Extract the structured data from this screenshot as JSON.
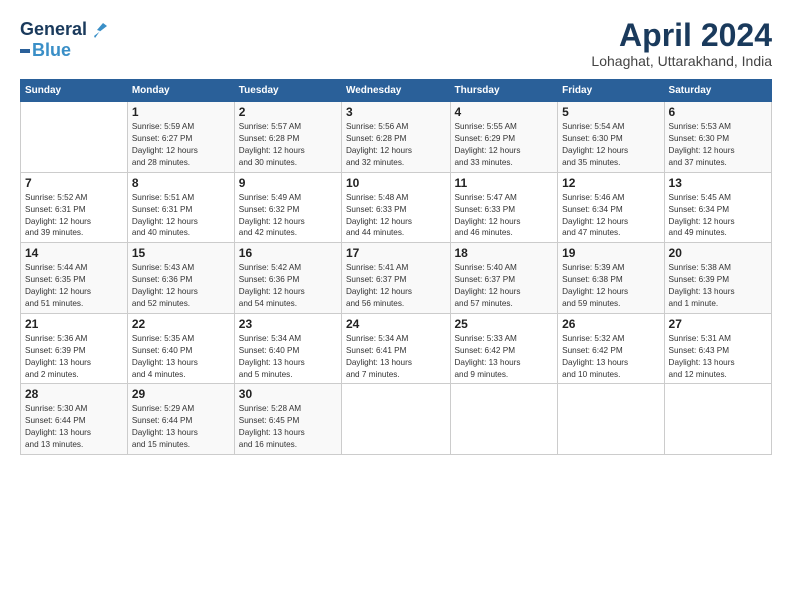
{
  "logo": {
    "line1": "General",
    "line2": "Blue"
  },
  "title": "April 2024",
  "location": "Lohaghat, Uttarakhand, India",
  "days_of_week": [
    "Sunday",
    "Monday",
    "Tuesday",
    "Wednesday",
    "Thursday",
    "Friday",
    "Saturday"
  ],
  "weeks": [
    [
      {
        "day": "",
        "data": ""
      },
      {
        "day": "1",
        "data": "Sunrise: 5:59 AM\nSunset: 6:27 PM\nDaylight: 12 hours\nand 28 minutes."
      },
      {
        "day": "2",
        "data": "Sunrise: 5:57 AM\nSunset: 6:28 PM\nDaylight: 12 hours\nand 30 minutes."
      },
      {
        "day": "3",
        "data": "Sunrise: 5:56 AM\nSunset: 6:28 PM\nDaylight: 12 hours\nand 32 minutes."
      },
      {
        "day": "4",
        "data": "Sunrise: 5:55 AM\nSunset: 6:29 PM\nDaylight: 12 hours\nand 33 minutes."
      },
      {
        "day": "5",
        "data": "Sunrise: 5:54 AM\nSunset: 6:30 PM\nDaylight: 12 hours\nand 35 minutes."
      },
      {
        "day": "6",
        "data": "Sunrise: 5:53 AM\nSunset: 6:30 PM\nDaylight: 12 hours\nand 37 minutes."
      }
    ],
    [
      {
        "day": "7",
        "data": "Sunrise: 5:52 AM\nSunset: 6:31 PM\nDaylight: 12 hours\nand 39 minutes."
      },
      {
        "day": "8",
        "data": "Sunrise: 5:51 AM\nSunset: 6:31 PM\nDaylight: 12 hours\nand 40 minutes."
      },
      {
        "day": "9",
        "data": "Sunrise: 5:49 AM\nSunset: 6:32 PM\nDaylight: 12 hours\nand 42 minutes."
      },
      {
        "day": "10",
        "data": "Sunrise: 5:48 AM\nSunset: 6:33 PM\nDaylight: 12 hours\nand 44 minutes."
      },
      {
        "day": "11",
        "data": "Sunrise: 5:47 AM\nSunset: 6:33 PM\nDaylight: 12 hours\nand 46 minutes."
      },
      {
        "day": "12",
        "data": "Sunrise: 5:46 AM\nSunset: 6:34 PM\nDaylight: 12 hours\nand 47 minutes."
      },
      {
        "day": "13",
        "data": "Sunrise: 5:45 AM\nSunset: 6:34 PM\nDaylight: 12 hours\nand 49 minutes."
      }
    ],
    [
      {
        "day": "14",
        "data": "Sunrise: 5:44 AM\nSunset: 6:35 PM\nDaylight: 12 hours\nand 51 minutes."
      },
      {
        "day": "15",
        "data": "Sunrise: 5:43 AM\nSunset: 6:36 PM\nDaylight: 12 hours\nand 52 minutes."
      },
      {
        "day": "16",
        "data": "Sunrise: 5:42 AM\nSunset: 6:36 PM\nDaylight: 12 hours\nand 54 minutes."
      },
      {
        "day": "17",
        "data": "Sunrise: 5:41 AM\nSunset: 6:37 PM\nDaylight: 12 hours\nand 56 minutes."
      },
      {
        "day": "18",
        "data": "Sunrise: 5:40 AM\nSunset: 6:37 PM\nDaylight: 12 hours\nand 57 minutes."
      },
      {
        "day": "19",
        "data": "Sunrise: 5:39 AM\nSunset: 6:38 PM\nDaylight: 12 hours\nand 59 minutes."
      },
      {
        "day": "20",
        "data": "Sunrise: 5:38 AM\nSunset: 6:39 PM\nDaylight: 13 hours\nand 1 minute."
      }
    ],
    [
      {
        "day": "21",
        "data": "Sunrise: 5:36 AM\nSunset: 6:39 PM\nDaylight: 13 hours\nand 2 minutes."
      },
      {
        "day": "22",
        "data": "Sunrise: 5:35 AM\nSunset: 6:40 PM\nDaylight: 13 hours\nand 4 minutes."
      },
      {
        "day": "23",
        "data": "Sunrise: 5:34 AM\nSunset: 6:40 PM\nDaylight: 13 hours\nand 5 minutes."
      },
      {
        "day": "24",
        "data": "Sunrise: 5:34 AM\nSunset: 6:41 PM\nDaylight: 13 hours\nand 7 minutes."
      },
      {
        "day": "25",
        "data": "Sunrise: 5:33 AM\nSunset: 6:42 PM\nDaylight: 13 hours\nand 9 minutes."
      },
      {
        "day": "26",
        "data": "Sunrise: 5:32 AM\nSunset: 6:42 PM\nDaylight: 13 hours\nand 10 minutes."
      },
      {
        "day": "27",
        "data": "Sunrise: 5:31 AM\nSunset: 6:43 PM\nDaylight: 13 hours\nand 12 minutes."
      }
    ],
    [
      {
        "day": "28",
        "data": "Sunrise: 5:30 AM\nSunset: 6:44 PM\nDaylight: 13 hours\nand 13 minutes."
      },
      {
        "day": "29",
        "data": "Sunrise: 5:29 AM\nSunset: 6:44 PM\nDaylight: 13 hours\nand 15 minutes."
      },
      {
        "day": "30",
        "data": "Sunrise: 5:28 AM\nSunset: 6:45 PM\nDaylight: 13 hours\nand 16 minutes."
      },
      {
        "day": "",
        "data": ""
      },
      {
        "day": "",
        "data": ""
      },
      {
        "day": "",
        "data": ""
      },
      {
        "day": "",
        "data": ""
      }
    ]
  ]
}
